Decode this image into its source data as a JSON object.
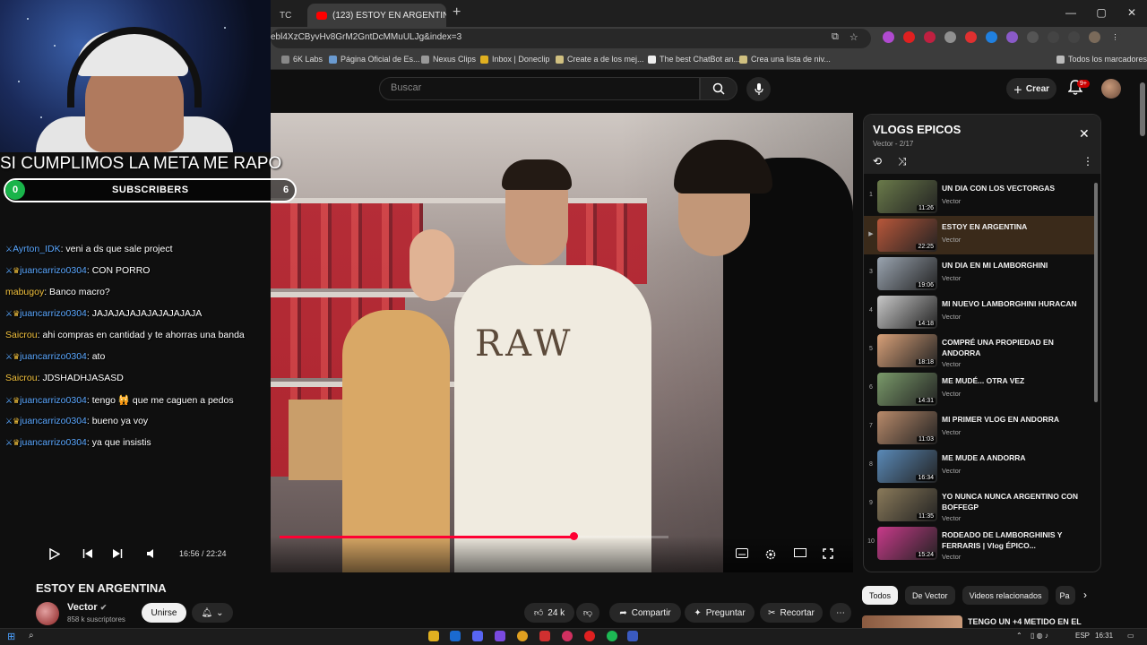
{
  "browser": {
    "tabs": [
      {
        "label": "TC"
      },
      {
        "label": "(123) ESTOY EN ARGENTINA -"
      }
    ],
    "url": "ebl4XzCByvHv8GrM2GntDcMMuULJg&index=3",
    "window_controls": [
      "—",
      "▢",
      "✕"
    ],
    "bookmarks": [
      "6K Labs",
      "Página Oficial de Es...",
      "Nexus Clips",
      "Inbox | Doneclip",
      "Create a de los mej...",
      "The best ChatBot an...",
      "Crea una lista de niv...",
      "Todos los marcadores"
    ]
  },
  "youtube": {
    "search_placeholder": "Buscar",
    "create_label": "Crear",
    "notif_badge": "9+"
  },
  "stream_overlay": {
    "goal_text": "SI CUMPLIMOS LA META ME RAPO",
    "goal_start": "0",
    "goal_label": "SUBSCRIBERS",
    "goal_end": "6",
    "chat": [
      {
        "user": "Ayrton_IDK",
        "msg": "veni a ds que sale project",
        "color": "blue"
      },
      {
        "user": "juancarrizo0304",
        "msg": "CON PORRO",
        "color": "blue"
      },
      {
        "user": "mabugoy",
        "msg": "Banco macro?",
        "color": "yellow"
      },
      {
        "user": "juancarrizo0304",
        "msg": "JAJAJAJAJAJAJAJAJAJA",
        "color": "blue"
      },
      {
        "user": "Saicrou",
        "msg": "ahi compras en cantidad y te ahorras una banda",
        "color": "yellow"
      },
      {
        "user": "juancarrizo0304",
        "msg": "ato",
        "color": "blue"
      },
      {
        "user": "Saicrou",
        "msg": "JDSHADHJASASD",
        "color": "yellow"
      },
      {
        "user": "juancarrizo0304",
        "msg": "tengo 🙀 que me caguen a pedos",
        "color": "blue"
      },
      {
        "user": "juancarrizo0304",
        "msg": "bueno ya voy",
        "color": "blue"
      },
      {
        "user": "juancarrizo0304",
        "msg": "ya que insistis",
        "color": "blue"
      }
    ]
  },
  "player": {
    "shirt_text": "RAW",
    "current_time": "16:56",
    "duration": "22:24",
    "time_display": "16:56 / 22:24",
    "progress_fraction": 0.756
  },
  "video": {
    "title": "ESTOY EN ARGENTINA",
    "channel": "Vector",
    "subscribers": "858 k suscriptores",
    "join_label": "Unirse",
    "likes": "24 k",
    "share_label": "Compartir",
    "ask_label": "Preguntar",
    "clip_label": "Recortar"
  },
  "playlist": {
    "title": "VLOGS EPICOS",
    "subtitle": "Vector - 2/17",
    "items": [
      {
        "index": "1",
        "title": "UN DIA CON LOS VECTORGAS",
        "channel": "Vector",
        "duration": "11:26",
        "thumb": "#6a7a4a"
      },
      {
        "index": "▶",
        "title": "ESTOY EN ARGENTINA",
        "channel": "Vector",
        "duration": "22:25",
        "thumb": "#b8573a",
        "current": true
      },
      {
        "index": "3",
        "title": "UN DIA EN MI LAMBORGHINI",
        "channel": "Vector",
        "duration": "19:06",
        "thumb": "#9aa4b0"
      },
      {
        "index": "4",
        "title": "MI NUEVO LAMBORGHINI HURACAN",
        "channel": "Vector",
        "duration": "14:18",
        "thumb": "#c8c8c8"
      },
      {
        "index": "5",
        "title": "COMPRÉ UNA PROPIEDAD EN ANDORRA",
        "channel": "Vector",
        "duration": "18:18",
        "thumb": "#d8a078"
      },
      {
        "index": "6",
        "title": "ME MUDÉ... OTRA VEZ",
        "channel": "Vector",
        "duration": "14:31",
        "thumb": "#7a9a6a"
      },
      {
        "index": "7",
        "title": "MI PRIMER VLOG EN ANDORRA",
        "channel": "Vector",
        "duration": "11:03",
        "thumb": "#b88a6a"
      },
      {
        "index": "8",
        "title": "ME MUDE A ANDORRA",
        "channel": "Vector",
        "duration": "16:34",
        "thumb": "#5a8ab8"
      },
      {
        "index": "9",
        "title": "YO NUNCA NUNCA ARGENTINO CON BOFFEGP",
        "channel": "Vector",
        "duration": "11:35",
        "thumb": "#8a7a5a"
      },
      {
        "index": "10",
        "title": "RODEADO DE LAMBORGHINIS Y FERRARIS | Vlog ÉPICO...",
        "channel": "Vector",
        "duration": "15:24",
        "thumb": "#c83a8a"
      }
    ]
  },
  "chips": [
    "Todos",
    "De Vector",
    "Videos relacionados",
    "Pa"
  ],
  "recommendation": {
    "title": "TENGO UN +4 METIDO EN EL"
  },
  "taskbar": {
    "lang": "ESP",
    "clock": "16:31"
  },
  "colors": {
    "accent_red": "#ff0033",
    "panel_bg": "#212121",
    "current_row": "#3a2a1a"
  }
}
